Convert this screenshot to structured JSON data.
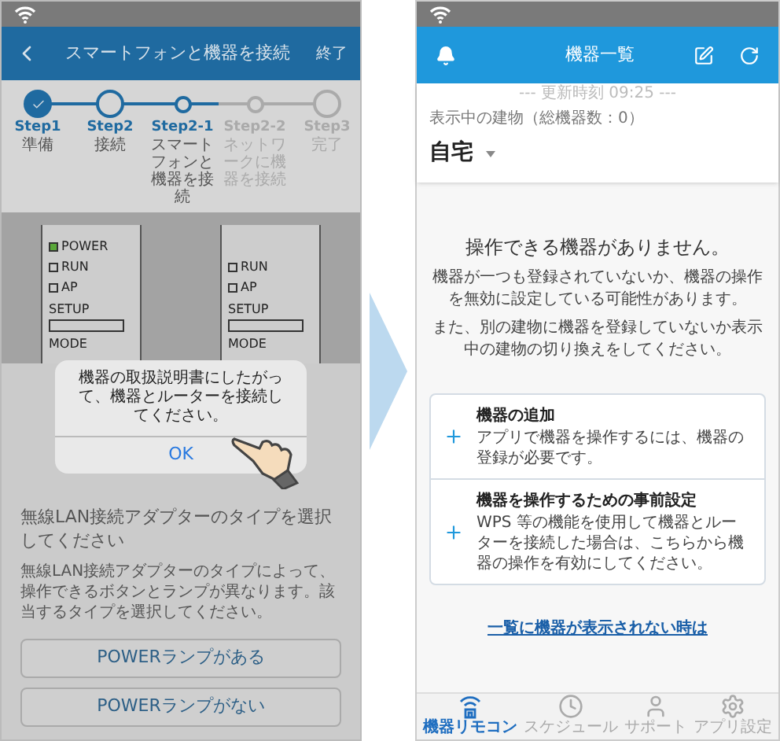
{
  "left_screen": {
    "header": {
      "title": "スマートフォンと機器を接続",
      "action": "終了"
    },
    "steps": [
      {
        "label": "Step1",
        "sub": "準備",
        "completed": true,
        "active": true,
        "major": true
      },
      {
        "label": "Step2",
        "sub": "接続",
        "completed": false,
        "active": true,
        "major": true
      },
      {
        "label": "Step2-1",
        "sub": "スマートフォンと機器を接続",
        "completed": false,
        "active": true,
        "major": false
      },
      {
        "label": "Step2-2",
        "sub": "ネットワークに機器を接続",
        "completed": false,
        "active": false,
        "major": false
      },
      {
        "label": "Step3",
        "sub": "完了",
        "completed": false,
        "active": false,
        "major": true
      }
    ],
    "devices": [
      {
        "lamps": [
          {
            "label": "POWER",
            "lit": true
          },
          {
            "label": "RUN",
            "lit": false
          },
          {
            "label": "AP",
            "lit": false
          }
        ],
        "setup": "SETUP",
        "mode": "MODE"
      },
      {
        "lamps": [
          {
            "label": "RUN",
            "lit": false
          },
          {
            "label": "AP",
            "lit": false
          }
        ],
        "setup": "SETUP",
        "mode": "MODE"
      }
    ],
    "dialog": {
      "message": "機器の取扱説明書にしたがって、機器とルーターを接続してください。",
      "button": "OK"
    },
    "heading": "無線LAN接続アダプターのタイプを選択してください",
    "description": "無線LAN接続アダプターのタイプによって、操作できるボタンとランプが異なります。該当するタイプを選択してください。",
    "options": [
      "POWERランプがある",
      "POWERランプがない"
    ]
  },
  "right_screen": {
    "header": {
      "title": "機器一覧"
    },
    "updated": "--- 更新時刻 09:25 ---",
    "building_label": "表示中の建物（総機器数：0）",
    "building": "自宅",
    "empty_title": "操作できる機器がありません。",
    "empty_message": [
      "機器が一つも登録されていないか、機器の操作を無効に設定している可能性があります。",
      "また、別の建物に機器を登録していないか表示中の建物の切り換えをしてください。"
    ],
    "actions": [
      {
        "title": "機器の追加",
        "description": "アプリで機器を操作するには、機器の登録が必要です。"
      },
      {
        "title": "機器を操作するための事前設定",
        "description": "WPS 等の機能を使用して機器とルーターを接続した場合は、こちらから機器の操作を有効にしてください。"
      }
    ],
    "help_link": "一覧に機器が表示されない時は",
    "tabs": [
      {
        "label": "機器リモコン",
        "selected": true
      },
      {
        "label": "スケジュール",
        "selected": false
      },
      {
        "label": "サポート",
        "selected": false
      },
      {
        "label": "アプリ設定",
        "selected": false
      }
    ]
  }
}
